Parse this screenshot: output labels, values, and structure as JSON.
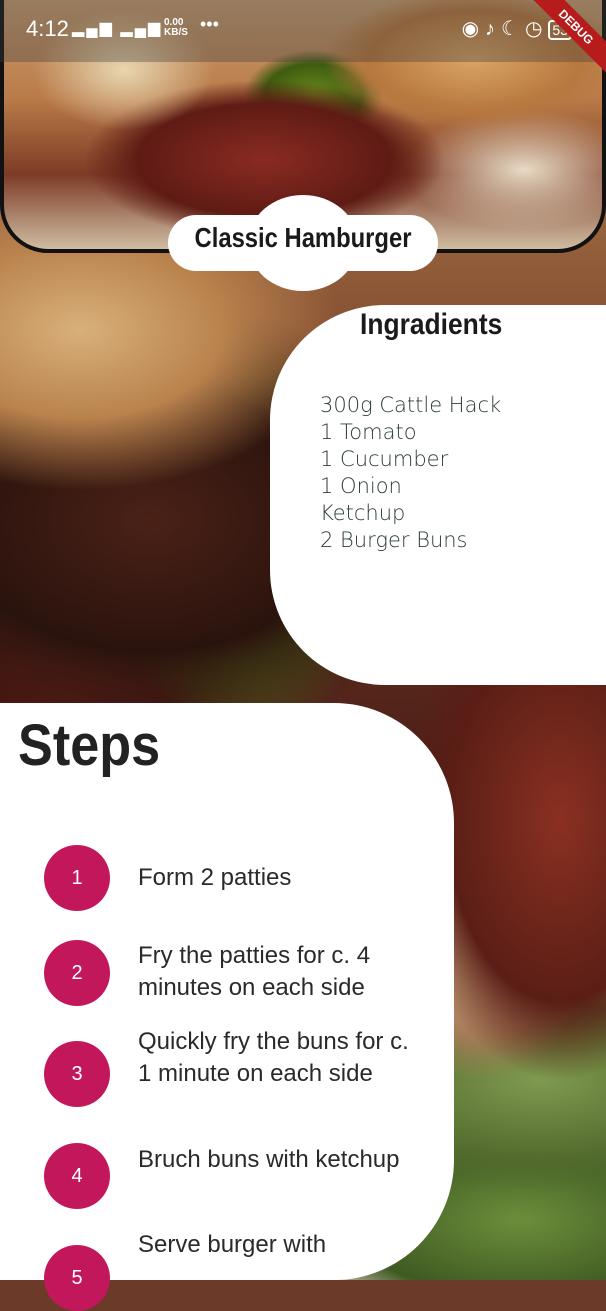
{
  "status_bar": {
    "time": "4:12",
    "speed_value": "0.00",
    "speed_unit": "KB/S",
    "more": "•••",
    "battery": "53"
  },
  "debug_banner": "DEBUG",
  "recipe": {
    "title": "Classic Hamburger"
  },
  "ingredients": {
    "heading": "Ingradients",
    "items": [
      "300g Cattle Hack",
      "1 Tomato",
      "1 Cucumber",
      "1 Onion",
      "Ketchup",
      "2 Burger Buns"
    ]
  },
  "steps": {
    "heading": "Steps",
    "items": [
      {
        "number": "1",
        "text": "Form 2 patties"
      },
      {
        "number": "2",
        "text": "Fry the patties for c. 4 minutes on each side"
      },
      {
        "number": "3",
        "text": "Quickly fry the buns for c. 1 minute on each side"
      },
      {
        "number": "4",
        "text": "Bruch buns with ketchup"
      },
      {
        "number": "5",
        "text": "Serve burger with"
      }
    ]
  },
  "colors": {
    "accent": "#c2185b",
    "panel": "#ffffff",
    "text_dark": "#2a2a2a"
  }
}
